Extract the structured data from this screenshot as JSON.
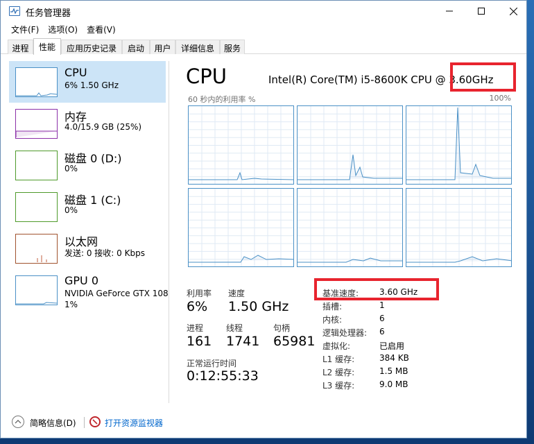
{
  "window": {
    "title": "任务管理器",
    "controls": {
      "minimize": "─",
      "maximize": "☐",
      "close": "✕"
    }
  },
  "menu": [
    "文件(F)",
    "选项(O)",
    "查看(V)"
  ],
  "tabs": [
    "进程",
    "性能",
    "应用历史记录",
    "启动",
    "用户",
    "详细信息",
    "服务"
  ],
  "active_tab": "性能",
  "sidebar": [
    {
      "title": "CPU",
      "sub": "6% 1.50 GHz",
      "sub2": "",
      "color": "#4a90c6",
      "active": true
    },
    {
      "title": "内存",
      "sub": "4.0/15.9 GB (25%)",
      "sub2": "",
      "color": "#8b2fa8",
      "active": false
    },
    {
      "title": "磁盘 0 (D:)",
      "sub": "0%",
      "sub2": "",
      "color": "#4e9a2a",
      "active": false
    },
    {
      "title": "磁盘 1 (C:)",
      "sub": "0%",
      "sub2": "",
      "color": "#4e9a2a",
      "active": false
    },
    {
      "title": "以太网",
      "sub": "发送: 0 接收: 0 Kbps",
      "sub2": "",
      "color": "#a0522d",
      "active": false
    },
    {
      "title": "GPU 0",
      "sub": "NVIDIA GeForce GTX 108",
      "sub2": "1%",
      "color": "#4a90c6",
      "active": false
    }
  ],
  "main": {
    "heading": "CPU",
    "model": "Intel(R) Core(TM) i5-8600K CPU @ 3.60GHz",
    "graph_caption_left": "60 秒内的利用率 %",
    "graph_caption_right": "100%",
    "cores": 6,
    "stats": {
      "util_label": "利用率",
      "util_value": "6%",
      "speed_label": "速度",
      "speed_value": "1.50 GHz",
      "proc_label": "进程",
      "proc_value": "161",
      "thread_label": "线程",
      "thread_value": "1741",
      "handle_label": "句柄",
      "handle_value": "65981",
      "uptime_label": "正常运行时间",
      "uptime_value": "0:12:55:33"
    },
    "details": [
      {
        "label": "基准速度:",
        "value": "3.60 GHz"
      },
      {
        "label": "插槽:",
        "value": "1"
      },
      {
        "label": "内核:",
        "value": "6"
      },
      {
        "label": "逻辑处理器:",
        "value": "6"
      },
      {
        "label": "虚拟化:",
        "value": "已启用"
      },
      {
        "label": "L1 缓存:",
        "value": "384 KB"
      },
      {
        "label": "L2 缓存:",
        "value": "1.5 MB"
      },
      {
        "label": "L3 缓存:",
        "value": "9.0 MB"
      }
    ]
  },
  "footer": {
    "less_details": "简略信息(D)",
    "open_monitor": "打开资源监视器"
  },
  "colors": {
    "accent": "#4a90c6",
    "selected": "#cce4f7",
    "highlight": "#e8242e",
    "link": "#0066cc"
  }
}
